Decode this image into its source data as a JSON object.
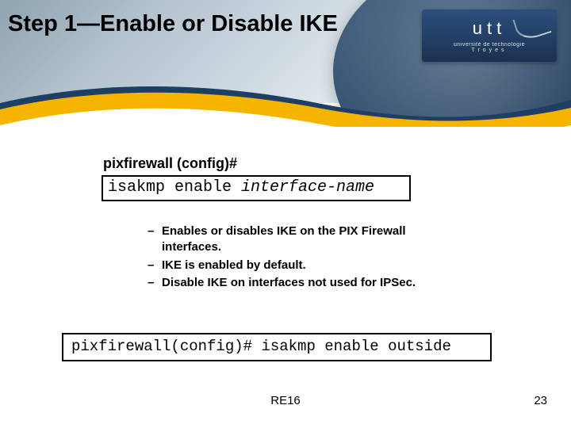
{
  "title": "Step 1—Enable or Disable IKE",
  "logo": {
    "brand": "utt",
    "sub1": "université de technologie",
    "sub2": "Troyes"
  },
  "prompt": "pixfirewall (config)#",
  "command": {
    "keyword": "isakmp enable ",
    "arg": "interface-name"
  },
  "bullets": [
    "Enables or disables IKE on the PIX Firewall interfaces.",
    "IKE is enabled by default.",
    "Disable IKE on interfaces not used for IPSec."
  ],
  "example": "pixfirewall(config)# isakmp enable outside",
  "footer": {
    "code": "RE16",
    "page": "23"
  }
}
